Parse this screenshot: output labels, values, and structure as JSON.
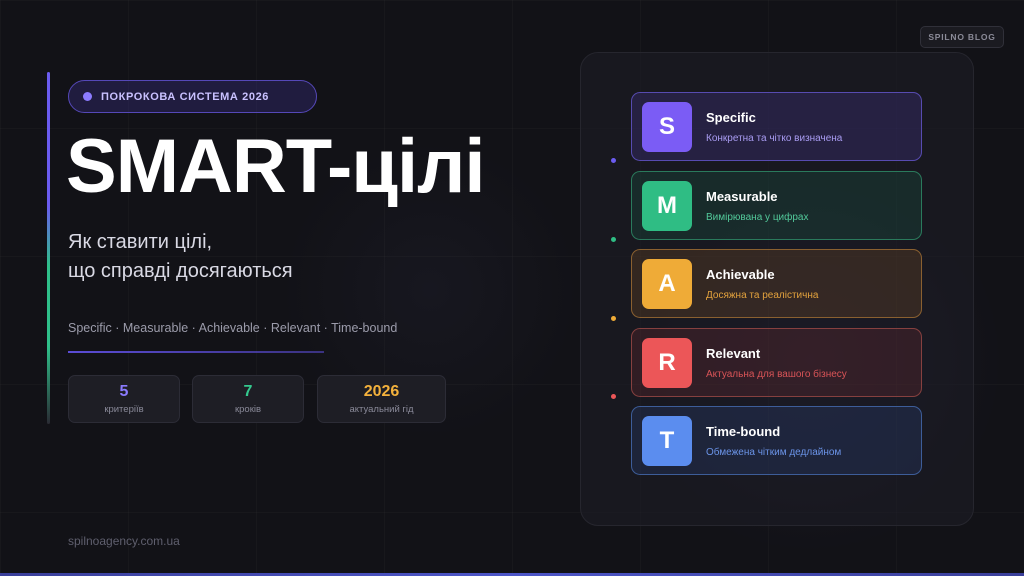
{
  "brand_badge": "SPILNO BLOG",
  "pill": {
    "text": "ПОКРОКОВА СИСТЕМА 2026"
  },
  "title": "SMART-цілі",
  "subtitle": [
    "Як ставити цілі,",
    "що справді досягаються"
  ],
  "criteria_line": "Specific · Measurable · Achievable · Relevant · Time-bound",
  "stats": [
    {
      "value": "5",
      "label": "критеріїв",
      "color": "#8b7bff"
    },
    {
      "value": "7",
      "label": "кроків",
      "color": "#34c98e"
    },
    {
      "value": "2026",
      "label": "актуальний гід",
      "color": "#f3b13c"
    }
  ],
  "footer_url": "spilnoagency.com.ua",
  "cards": [
    {
      "letter": "S",
      "title": "Specific",
      "desc": "Конкретна та чітко визначена",
      "color": "#7b5cf5",
      "desc_color": "#a99cf2",
      "bg": "rgba(95,70,210,0.20)",
      "border": "#574bb0"
    },
    {
      "letter": "M",
      "title": "Measurable",
      "desc": "Вимірювана у цифрах",
      "color": "#2fbd84",
      "desc_color": "#52c99a",
      "bg": "rgba(30,140,100,0.17)",
      "border": "#2a7a5c"
    },
    {
      "letter": "A",
      "title": "Achievable",
      "desc": "Досяжна та реалістична",
      "color": "#efab37",
      "desc_color": "#e3a23d",
      "bg": "rgba(190,120,40,0.17)",
      "border": "#8a6030"
    },
    {
      "letter": "R",
      "title": "Relevant",
      "desc": "Актуальна для вашого бізнесу",
      "color": "#ec5658",
      "desc_color": "#d95457",
      "bg": "rgba(180,60,60,0.17)",
      "border": "#86403f"
    },
    {
      "letter": "T",
      "title": "Time-bound",
      "desc": "Обмежена чітким дедлайном",
      "color": "#5b8def",
      "desc_color": "#6b94e8",
      "bg": "rgba(60,100,190,0.17)",
      "border": "#3d5d99"
    }
  ]
}
